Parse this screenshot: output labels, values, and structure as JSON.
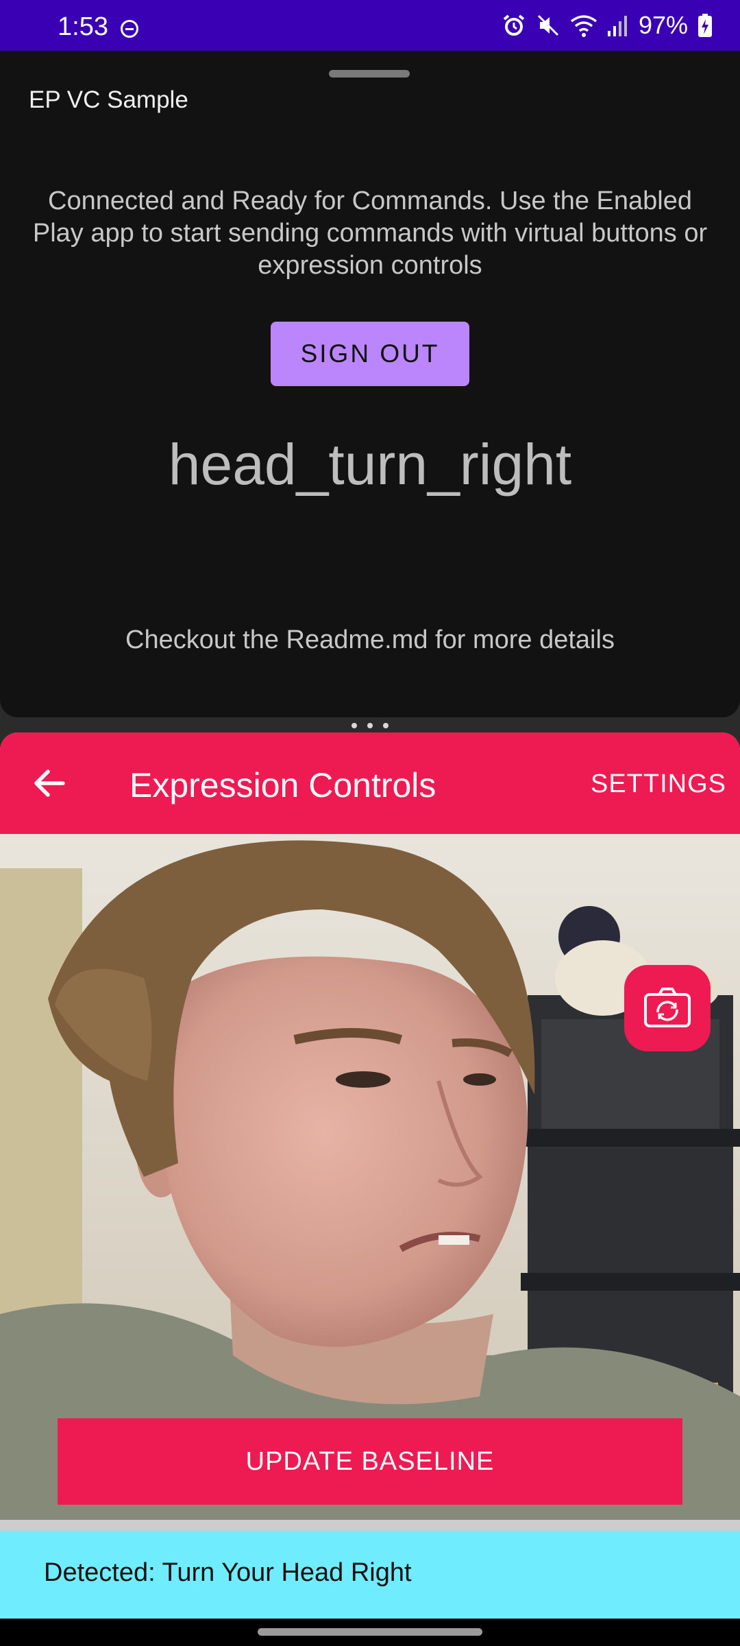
{
  "status_bar": {
    "time": "1:53",
    "battery": "97%",
    "icons": [
      "do-not-disturb-icon",
      "alarm-icon",
      "mute-icon",
      "wifi-icon",
      "signal-icon",
      "battery-charging-icon"
    ]
  },
  "top_app": {
    "title": "EP VC Sample",
    "status_message": "Connected and Ready for Commands. Use the Enabled Play app to start sending commands with virtual buttons or expression controls",
    "sign_out_label": "SIGN OUT",
    "gesture": "head_turn_right",
    "readme_note": "Checkout the Readme.md for more details"
  },
  "bottom_app": {
    "toolbar": {
      "title": "Expression Controls",
      "settings_label": "SETTINGS",
      "back_icon": "arrow-back-icon"
    },
    "camera_switch_icon": "camera-switch-icon",
    "update_baseline_label": "UPDATE BASELINE",
    "detected_text": "Detected: Turn Your Head Right"
  },
  "colors": {
    "status_bar": "#3a00b3",
    "accent": "#ee1a52",
    "primary_button": "#bb86fc",
    "detected_bar": "#70ecff",
    "dark_surface": "#121212"
  }
}
